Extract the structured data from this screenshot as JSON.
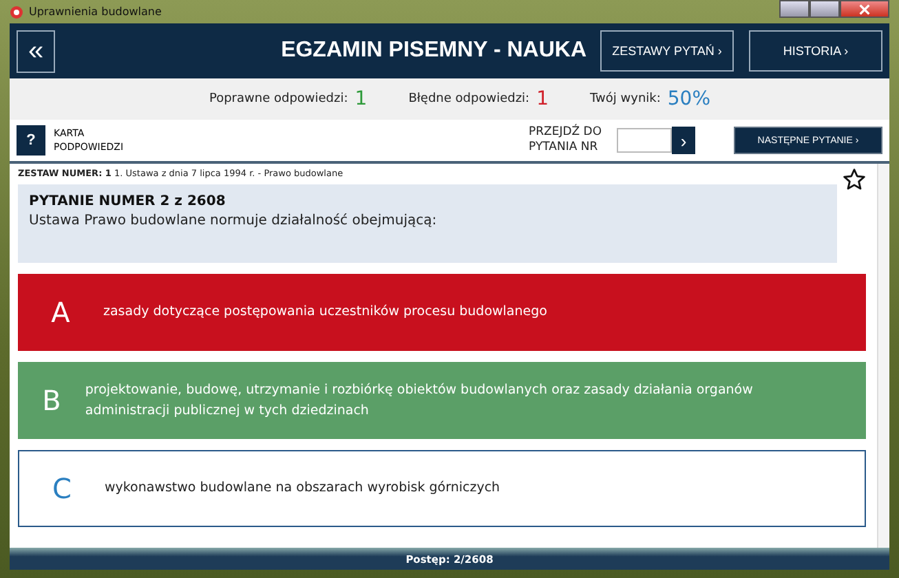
{
  "window": {
    "title": "Uprawnienia budowlane"
  },
  "header": {
    "back_icon": "«",
    "title": "EGZAMIN PISEMNY - NAUKA",
    "buttons": [
      "ZESTAWY PYTAŃ ›",
      "HISTORIA ›"
    ]
  },
  "stats": [
    {
      "label": "Poprawne odpowiedzi:",
      "value": "1",
      "color": "#2e9a3a"
    },
    {
      "label": "Błędne odpowiedzi:",
      "value": "1",
      "color": "#d0202a"
    },
    {
      "label": "Twój wynik:",
      "value": "50%",
      "color": "#2a7fc0"
    }
  ],
  "toolbar": {
    "hint_button": "?",
    "hint_label": "KARTA PODPOWIEDZI",
    "goto_label": "PRZEJDŹ DO PYTANIA NR",
    "goto_button": "›",
    "next_button": "NASTĘPNE PYTANIE ›"
  },
  "set_line": "**ZESTAW NUMER: 1** 1. Ustawa z dnia 7 lipca 1994 r. - Prawo budowlane",
  "question": {
    "title": "PYTANIE NUMER 2 z 2608",
    "text": "Ustawa Prawo budowlane normuje działalność obejmującą:",
    "starred": false
  },
  "answers": [
    {
      "letter": "A",
      "text": "zasady dotyczące postępowania uczestników procesu budowlanego",
      "kind": "wrong"
    },
    {
      "letter": "B",
      "text": "projektowanie, budowę, utrzymanie i rozbiórkę obiektów budowlanych oraz zasady działania organów administracji publicznej w tych dziedzinach",
      "kind": "correct"
    },
    {
      "letter": "C",
      "text": "wykonawstwo budowlane na obszarach wyrobisk górniczych",
      "kind": "neutral"
    }
  ],
  "status_bar": "Postęp: 2/2608"
}
